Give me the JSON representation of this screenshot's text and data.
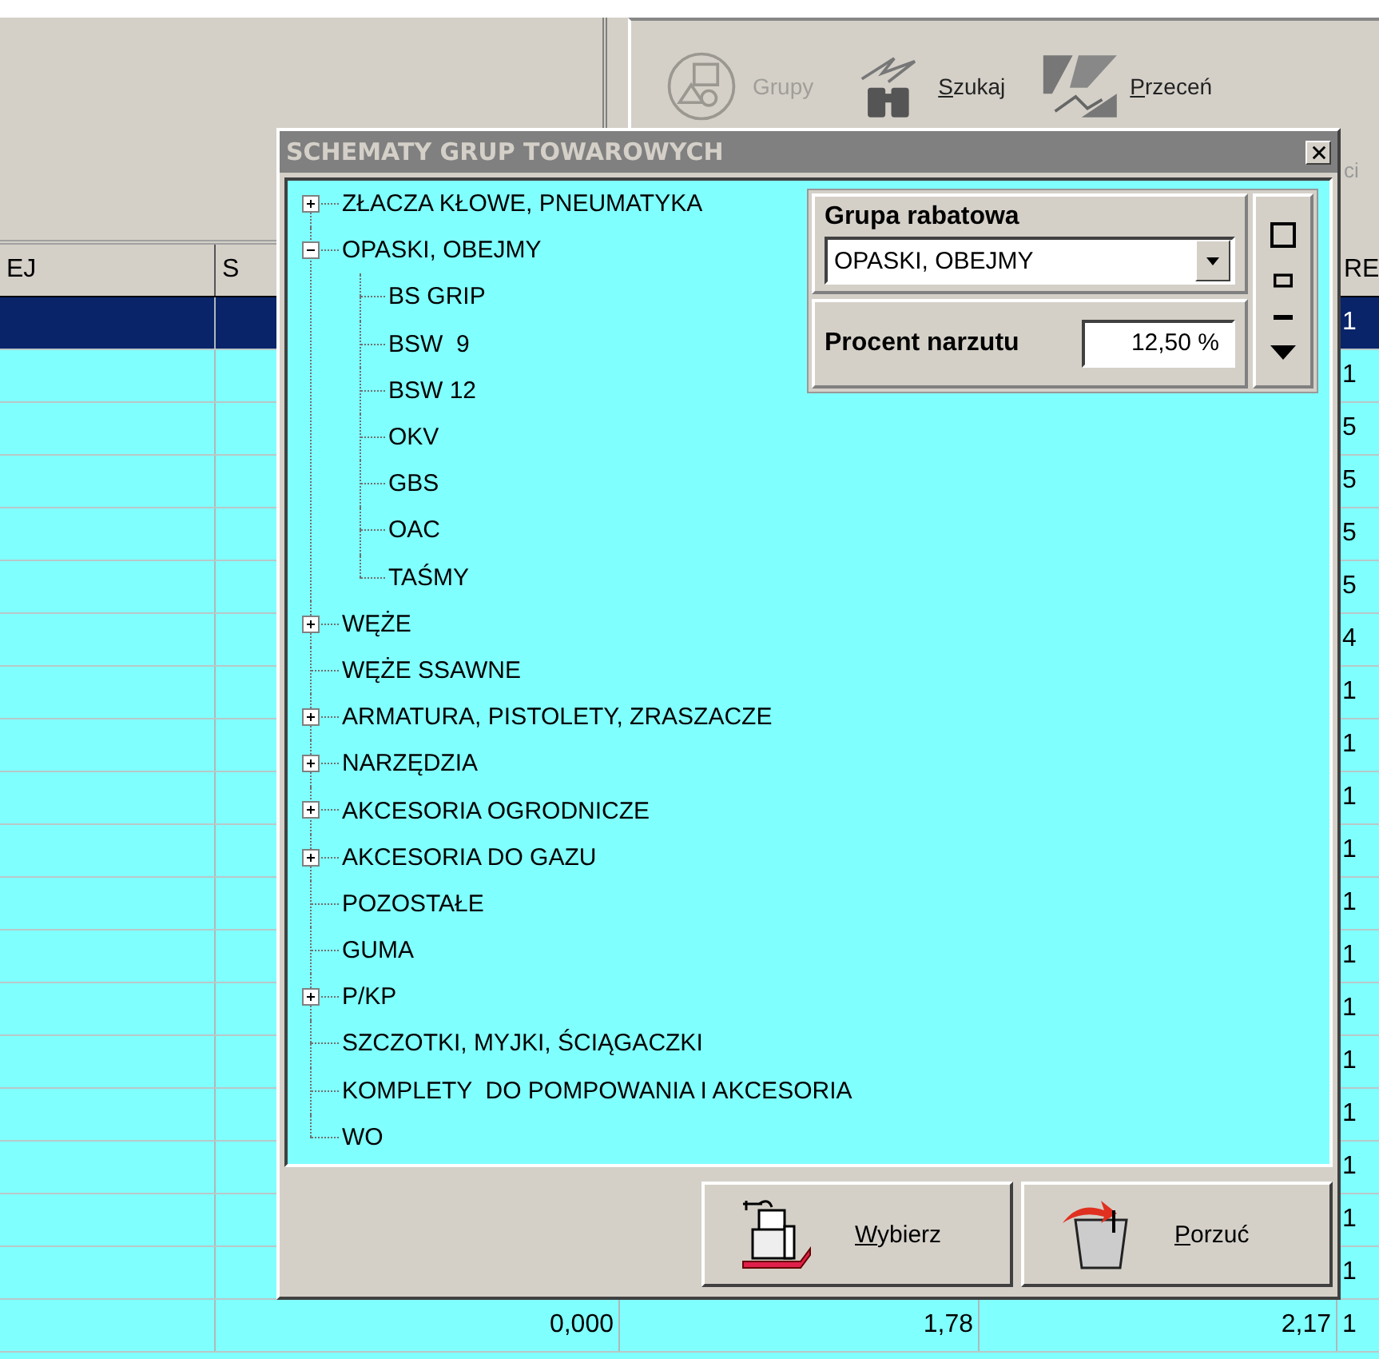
{
  "toolbar": {
    "buttons": [
      {
        "label": "Grupy",
        "disabled": true,
        "mnemonic": false,
        "kind": "groups"
      },
      {
        "label": "Szukaj",
        "disabled": false,
        "mnemonic": true,
        "kind": "search"
      },
      {
        "label": "Przeceń",
        "disabled": false,
        "mnemonic": true,
        "kind": "reprice"
      }
    ],
    "hidden_label": "ci"
  },
  "grid": {
    "header": {
      "column_1": "EJ",
      "column_2": "S",
      "column_5": "RE"
    },
    "rows": [
      {
        "selected": true,
        "column_5": "1"
      },
      {
        "selected": false,
        "column_5": "1"
      },
      {
        "selected": false,
        "column_5": "5"
      },
      {
        "selected": false,
        "column_5": "5"
      },
      {
        "selected": false,
        "column_5": "5"
      },
      {
        "selected": false,
        "column_5": "5"
      },
      {
        "selected": false,
        "column_5": "4"
      },
      {
        "selected": false,
        "column_5": "1"
      },
      {
        "selected": false,
        "column_5": "1"
      },
      {
        "selected": false,
        "column_5": "1"
      },
      {
        "selected": false,
        "column_5": "1"
      },
      {
        "selected": false,
        "column_5": "1"
      },
      {
        "selected": false,
        "column_5": "1"
      },
      {
        "selected": false,
        "column_5": "1"
      },
      {
        "selected": false,
        "column_5": "1"
      },
      {
        "selected": false,
        "column_5": "1"
      },
      {
        "selected": false,
        "column_5": "1"
      },
      {
        "selected": false,
        "column_5": "1"
      },
      {
        "selected": false,
        "column_5": "1"
      },
      {
        "selected": false,
        "column_2": "0,000",
        "column_3": "1,78",
        "column_4": "2,17",
        "column_5": "1"
      }
    ]
  },
  "dialog": {
    "title": "SCHEMATY GRUP TOWAROWYCH",
    "tree": [
      {
        "label": "ZŁACZA KŁOWE, PNEUMATYKA",
        "expanded": false
      },
      {
        "label": "OPASKI, OBEJMY",
        "expanded": true,
        "children": [
          {
            "label": "BS GRIP"
          },
          {
            "label": "BSW  9"
          },
          {
            "label": "BSW 12"
          },
          {
            "label": "OKV"
          },
          {
            "label": "GBS"
          },
          {
            "label": "OAC"
          },
          {
            "label": "TAŚMY"
          }
        ]
      },
      {
        "label": "WĘŻE",
        "expanded": false
      },
      {
        "label": "WĘŻE SSAWNE"
      },
      {
        "label": "ARMATURA, PISTOLETY, ZRASZACZE",
        "expanded": false
      },
      {
        "label": "NARZĘDZIA",
        "expanded": false
      },
      {
        "label": "AKCESORIA OGRODNICZE",
        "expanded": false
      },
      {
        "label": "AKCESORIA DO GAZU",
        "expanded": false
      },
      {
        "label": "POZOSTAŁE"
      },
      {
        "label": "GUMA"
      },
      {
        "label": "P/KP",
        "expanded": false
      },
      {
        "label": "SZCZOTKI, MYJKI, ŚCIĄGACZKI"
      },
      {
        "label": "KOMPLETY  DO POMPOWANIA I AKCESORIA"
      },
      {
        "label": "WO"
      }
    ],
    "discount_panel": {
      "group_label": "Grupa rabatowa",
      "group_value": "OPASKI, OBEJMY",
      "markup_label": "Procent narzutu",
      "markup_value": "12,50 %"
    },
    "buttons": [
      {
        "label": "Wybierz",
        "kind": "select",
        "mnemonic": true
      },
      {
        "label": "Porzuć",
        "kind": "abandon",
        "mnemonic": true
      }
    ]
  }
}
